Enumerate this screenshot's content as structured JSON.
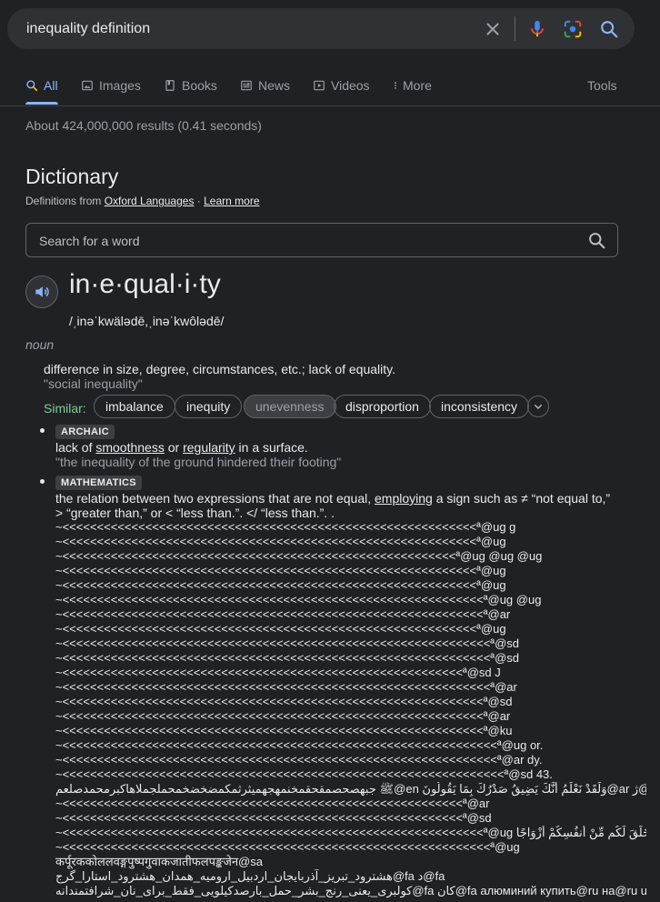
{
  "search": {
    "query": "inequality definition"
  },
  "tabs": [
    {
      "label": "All",
      "icon": "search-icon"
    },
    {
      "label": "Images",
      "icon": "image-icon"
    },
    {
      "label": "Books",
      "icon": "book-icon"
    },
    {
      "label": "News",
      "icon": "news-icon"
    },
    {
      "label": "Videos",
      "icon": "video-icon"
    },
    {
      "label": "More",
      "icon": "more-vert-icon"
    }
  ],
  "tools_label": "Tools",
  "result_stats": "About 424,000,000 results (0.41 seconds)",
  "dictionary": {
    "title": "Dictionary",
    "source_prefix": "Definitions from ",
    "source_link": "Oxford Languages",
    "separator": " · ",
    "learn_more": "Learn more",
    "search_placeholder": "Search for a word",
    "headword": "in·e·qual·i·ty",
    "phonetic": "/ˌinəˈkwälədē,ˌinəˈkwôlədē/",
    "part_of_speech": "noun",
    "sense1": {
      "definition": "difference in size, degree, circumstances, etc.; lack of equality.",
      "example": "\"social inequality\""
    },
    "similar_label": "Similar:",
    "similar": [
      "imbalance",
      "inequity",
      "unevenness",
      "disproportion",
      "inconsistency"
    ],
    "sense2": {
      "tag": "ARCHAIC",
      "text_a": "lack of ",
      "link_a": "smoothness",
      "text_b": " or ",
      "link_b": "regularity",
      "text_c": " in a surface.",
      "example": "\"the inequality of the ground hindered their footing\""
    },
    "sense3": {
      "tag": "MATHEMATICS",
      "line1_a": "the relation between two expressions that are not equal, ",
      "line1_link": "employing",
      "line1_b": " a sign such as ≠ “not equal to,”",
      "line2": "> “greater than,” or < “less than.”. </ “less than.”. ."
    },
    "garbage_lines": [
      "~<<<<<<<<<<<<<<<<<<<<<<<<<<<<<<<<<<<<<<<<<<<<<<<<<<<<<<<<<<<<ª@ug g",
      "~<<<<<<<<<<<<<<<<<<<<<<<<<<<<<<<<<<<<<<<<<<<<<<<<<<<<<<<<<<<<ª@ug",
      "~<<<<<<<<<<<<<<<<<<<<<<<<<<<<<<<<<<<<<<<<<<<<<<<<<<<<<<<<<ª@ug @ug @ug",
      "~<<<<<<<<<<<<<<<<<<<<<<<<<<<<<<<<<<<<<<<<<<<<<<<<<<<<<<<<<<<<ª@ug",
      "~<<<<<<<<<<<<<<<<<<<<<<<<<<<<<<<<<<<<<<<<<<<<<<<<<<<<<<<<<<<<ª@ug",
      "~<<<<<<<<<<<<<<<<<<<<<<<<<<<<<<<<<<<<<<<<<<<<<<<<<<<<<<<<<<<<<ª@ug @ug",
      "~<<<<<<<<<<<<<<<<<<<<<<<<<<<<<<<<<<<<<<<<<<<<<<<<<<<<<<<<<<<<<ª@ar",
      "~<<<<<<<<<<<<<<<<<<<<<<<<<<<<<<<<<<<<<<<<<<<<<<<<<<<<<<<<<<<<ª@ug",
      "~<<<<<<<<<<<<<<<<<<<<<<<<<<<<<<<<<<<<<<<<<<<<<<<<<<<<<<<<<<<<<<ª@sd",
      "~<<<<<<<<<<<<<<<<<<<<<<<<<<<<<<<<<<<<<<<<<<<<<<<<<<<<<<<<<<<<<<ª@sd",
      "~<<<<<<<<<<<<<<<<<<<<<<<<<<<<<<<<<<<<<<<<<<<<<<<<<<<<<<<<<<ª@sd J",
      "~<<<<<<<<<<<<<<<<<<<<<<<<<<<<<<<<<<<<<<<<<<<<<<<<<<<<<<<<<<<<<<ª@ar",
      "~<<<<<<<<<<<<<<<<<<<<<<<<<<<<<<<<<<<<<<<<<<<<<<<<<<<<<<<<<<<<<ª@sd",
      "~<<<<<<<<<<<<<<<<<<<<<<<<<<<<<<<<<<<<<<<<<<<<<<<<<<<<<<<<<<<<<ª@ar",
      "~<<<<<<<<<<<<<<<<<<<<<<<<<<<<<<<<<<<<<<<<<<<<<<<<<<<<<<<<<<<<<ª@ku",
      "~<<<<<<<<<<<<<<<<<<<<<<<<<<<<<<<<<<<<<<<<<<<<<<<<<<<<<<<<<<<<<<<ª@ug or.",
      "~<<<<<<<<<<<<<<<<<<<<<<<<<<<<<<<<<<<<<<<<<<<<<<<<<<<<<<<<<<<<<<<ª@ar dy.",
      "~<<<<<<<<<<<<<<<<<<<<<<<<<<<<<<<<<<<<<<<<<<<<<<<<<<<<<<<<<<<<<<<<ª@sd 43.",
      "ﷺ جبهصحصمقحقمخنمهجهميثرثمكمضخضخمحملجملاهاكبرمحمدصلعم@en وَلَقَدْ نَعْلَمُ أَنَّكَ يَضِيقُ صَدْرُكَ بِمَا يَقُولُونَ@ar ژ@ar",
      "~<<<<<<<<<<<<<<<<<<<<<<<<<<<<<<<<<<<<<<<<<<<<<<<<<<<<<<<<<<ª@ar",
      "~<<<<<<<<<<<<<<<<<<<<<<<<<<<<<<<<<<<<<<<<<<<<<<<<<<<<<<<<<<ª@sd",
      "~<<<<<<<<<<<<<<<<<<<<<<<<<<<<<<<<<<<<<<<<<<<<<<<<<<<<<<<<<<<<<ª@ug وَمِنْ آيَاتِهِ أَنْ خَلَقَ لَكُم مِّنْ أَنفُسِكُمْ أَزْوَاجًا@ar ter.",
      "~<<<<<<<<<<<<<<<<<<<<<<<<<<<<<<<<<<<<<<<<<<<<<<<<<<<<<<<<<<<<<<ª@ug",
      "कर्पूरककोललवङ्गपुष्पगुवाकजातीफलपङ्कजेन@sa",
      "هشترود_تبریز_آذربایجان_اردبیل_ارومیه_همدان_هشترود_استارا_گرج@fa د@fa",
      "كولبری_یعنی_رنج_بشر_حمل_بارصدکیلویی_فقط_برای_نان_شرافتمندانه@fa كان@fa алюминий купить@ru на@ru u"
    ]
  }
}
